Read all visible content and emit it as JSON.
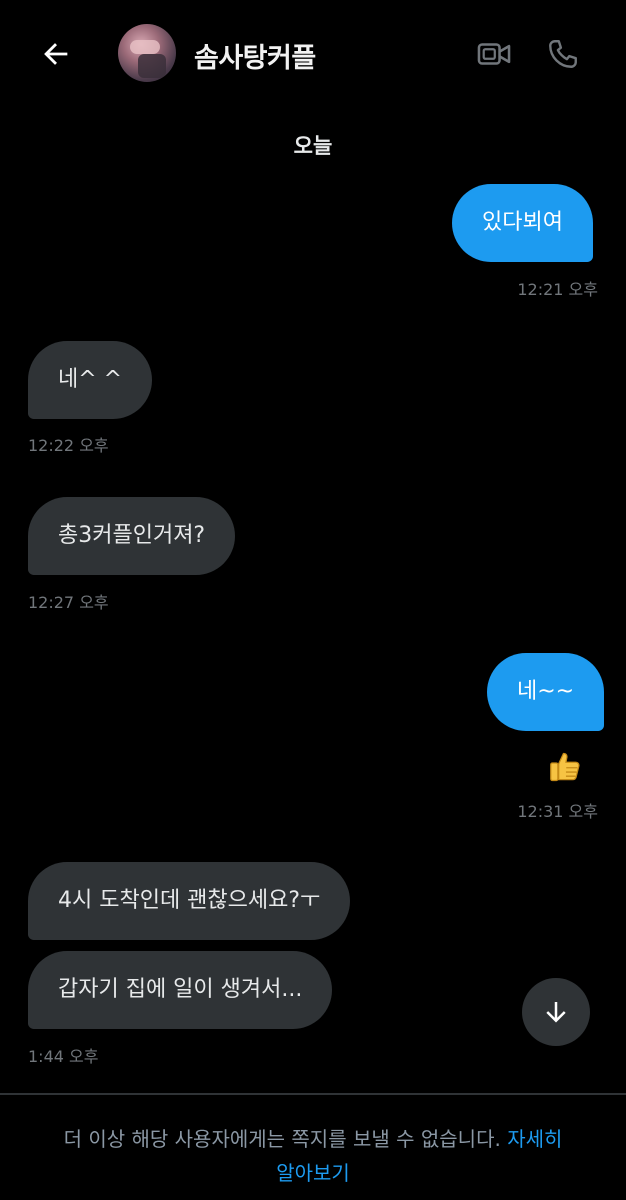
{
  "header": {
    "title": "솜사탕커플",
    "back_icon": "arrow-left-icon",
    "video_icon": "video-camera-icon",
    "call_icon": "phone-icon"
  },
  "date_divider": "오늘",
  "messages": [
    {
      "direction": "sent",
      "text": "있다뵈여",
      "time": "12:21 오후"
    },
    {
      "direction": "received",
      "text": "네^ ^",
      "time": "12:22 오후"
    },
    {
      "direction": "received",
      "text": "총3커플인거져?",
      "time": "12:27 오후"
    },
    {
      "direction": "sent",
      "text": "네~~",
      "reaction": "👍",
      "time": "12:31 오후"
    },
    {
      "direction": "received",
      "text": "4시 도착인데 괜찮으세요?ㅜ"
    },
    {
      "direction": "received",
      "text": "갑자기 집에 일이 생겨서...",
      "time": "1:44 오후"
    }
  ],
  "scroll_button_icon": "arrow-down-icon",
  "footer": {
    "notice": "더 이상 해당 사용자에게는 쪽지를 보낼 수 없습니다. ",
    "link_part1": "자세히",
    "link_part2": "알아보기"
  },
  "colors": {
    "background": "#000000",
    "sent_bubble": "#1d9bf0",
    "received_bubble": "#2f3336",
    "timestamp": "#71767b",
    "link": "#1d9bf0"
  }
}
